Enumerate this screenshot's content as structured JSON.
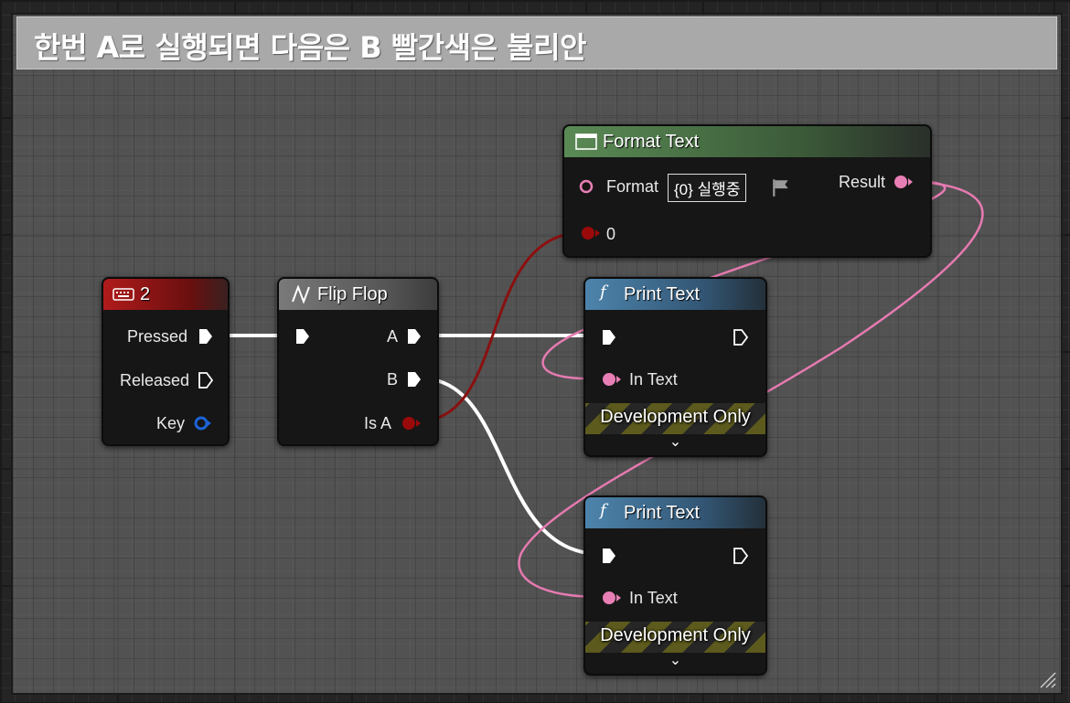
{
  "comment": {
    "title": "한번 A로 실행되면 다음은 B 빨간색은 불리안"
  },
  "key_node": {
    "title": "2",
    "icon": "keyboard-icon",
    "header_color": "#a01a1a",
    "pins": {
      "pressed": "Pressed",
      "released": "Released",
      "key": "Key"
    }
  },
  "flipflop_node": {
    "title": "Flip Flop",
    "icon": "flip-flop-icon",
    "header_color": "#6e6e6e",
    "pins": {
      "a": "A",
      "b": "B",
      "is_a": "Is A"
    }
  },
  "format_node": {
    "title": "Format Text",
    "icon": "format-text-icon",
    "header_color": "#4f6e4a",
    "pins": {
      "format": "Format",
      "result": "Result",
      "zero": "0"
    },
    "format_value": "{0} 실행중"
  },
  "print_nodes": [
    {
      "title": "Print Text",
      "icon": "function-icon",
      "header_color": "#3d6482",
      "in_text": "In Text",
      "dev_only": "Development Only"
    },
    {
      "title": "Print Text",
      "icon": "function-icon",
      "header_color": "#3d6482",
      "in_text": "In Text",
      "dev_only": "Development Only"
    }
  ],
  "colors": {
    "exec_wire": "#ffffff",
    "bool_wire": "#8a1010",
    "text_wire": "#e57ab0",
    "bool_pin": "#9a0a0a",
    "text_pin": "#e77fb5",
    "struct_pin": "#1c63d6"
  }
}
